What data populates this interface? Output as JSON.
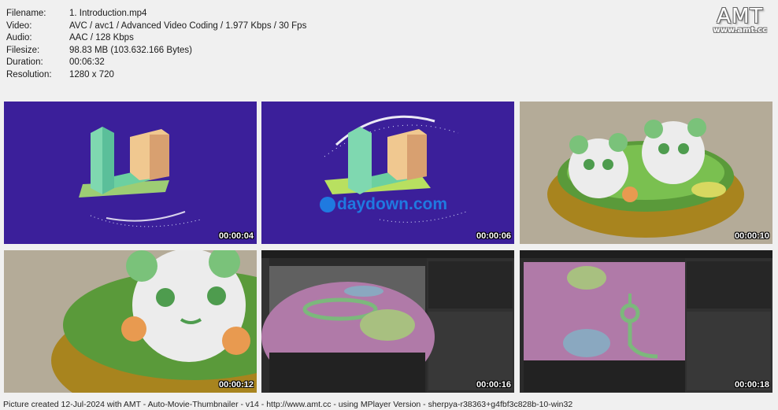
{
  "file_info": {
    "filename": {
      "label": "Filename:",
      "value": "1. Introduction.mp4"
    },
    "video": {
      "label": "Video:",
      "value": "AVC / avc1 / Advanced Video Coding / 1.977 Kbps / 30 Fps"
    },
    "audio": {
      "label": "Audio:",
      "value": "AAC / 128 Kbps"
    },
    "filesize": {
      "label": "Filesize:",
      "value": "98.83 MB (103.632.166 Bytes)"
    },
    "duration": {
      "label": "Duration:",
      "value": "00:06:32"
    },
    "resolution": {
      "label": "Resolution:",
      "value": "1280 x 720"
    }
  },
  "watermark": {
    "title": "AMT",
    "url": "www.amt.cc"
  },
  "thumbnails": [
    {
      "time": "00:00:04",
      "scene": "logo-intro"
    },
    {
      "time": "00:00:06",
      "scene": "logo-watermark",
      "overlay_text": "daydown.com"
    },
    {
      "time": "00:00:10",
      "scene": "bento-pandas"
    },
    {
      "time": "00:00:12",
      "scene": "bento-closeup"
    },
    {
      "time": "00:00:16",
      "scene": "blender-editor"
    },
    {
      "time": "00:00:18",
      "scene": "blender-editor-2"
    }
  ],
  "footer": "Picture created 12-Jul-2024 with AMT - Auto-Movie-Thumbnailer - v14 - http://www.amt.cc - using MPlayer Version - sherpya-r38363+g4fbf3c828b-10-win32",
  "colors": {
    "background": "#f0f0f0",
    "logo_bg": "#3b1f9a",
    "bento_bg": "#b4ab98",
    "blender_bg": "#2b2b2b",
    "mesh_pink": "#b07aa8"
  }
}
